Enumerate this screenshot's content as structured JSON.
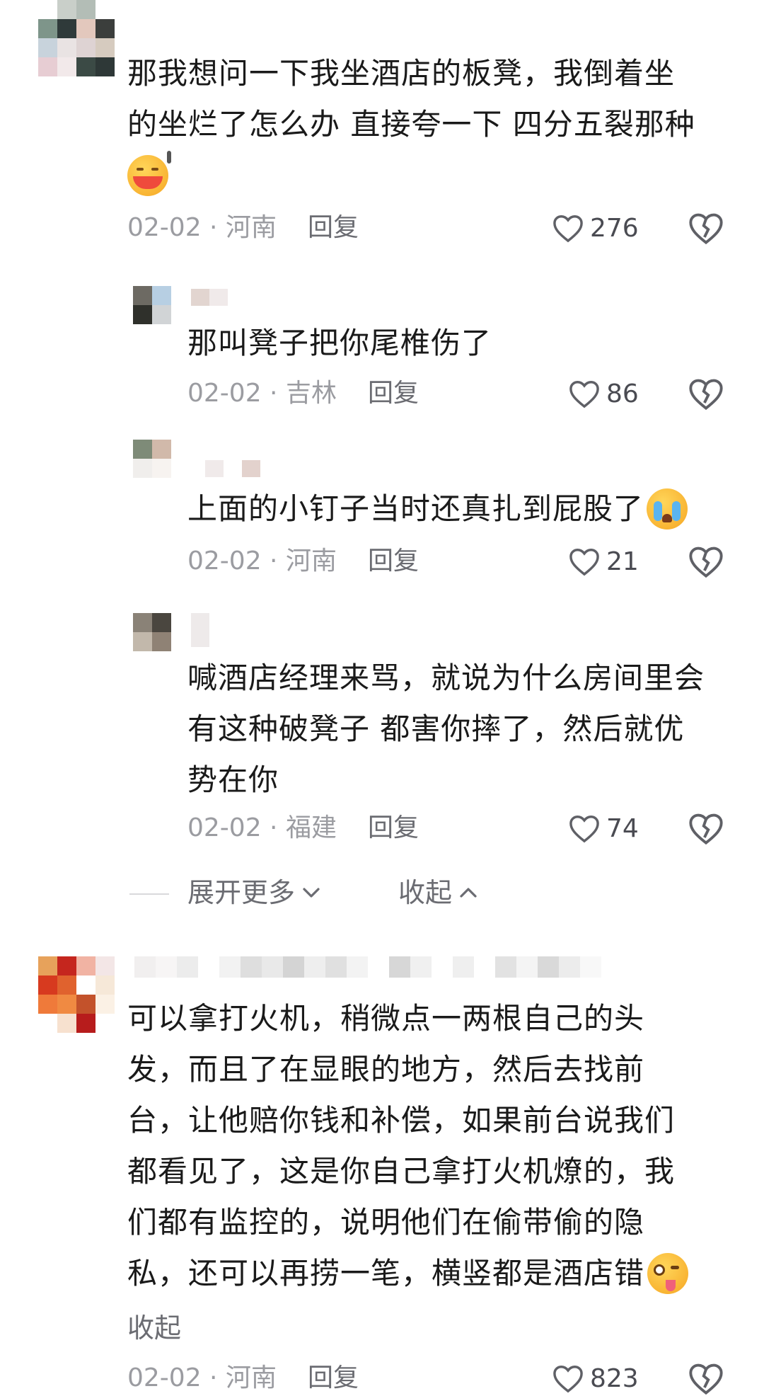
{
  "comments": [
    {
      "text_lines": [
        "那我想问一下我坐酒店的板凳，我倒着坐",
        "的坐烂了怎么办 直接夸一下 四分五裂那种"
      ],
      "date_location": "02-02 · 河南",
      "reply_label": "回复",
      "likes": "276",
      "emoji": "grinning-sweat-emoji"
    }
  ],
  "replies": [
    {
      "text_lines": [
        "那叫凳子把你尾椎伤了"
      ],
      "date_location": "02-02 · 吉林",
      "reply_label": "回复",
      "likes": "86"
    },
    {
      "text_lines": [
        "上面的小钉子当时还真扎到屁股了"
      ],
      "date_location": "02-02 · 河南",
      "reply_label": "回复",
      "likes": "21",
      "emoji": "crying-emoji"
    },
    {
      "text_lines": [
        "喊酒店经理来骂，就说为什么房间里会",
        "有这种破凳子 都害你摔了，然后就优",
        "势在你"
      ],
      "date_location": "02-02 · 福建",
      "reply_label": "回复",
      "likes": "74"
    }
  ],
  "thread_controls": {
    "expand_more": "展开更多",
    "collapse": "收起"
  },
  "second_comment": {
    "text_lines": [
      "可以拿打火机，稍微点一两根自己的头",
      "发，而且了在显眼的地方，然后去找前",
      "台，让他赔你钱和补偿，如果前台说我们",
      "都看见了，这是你自己拿打火机燎的，我",
      "们都有监控的，说明他们在偷带偷的隐",
      "私，还可以再捞一笔，横竖都是酒店错"
    ],
    "collapse_label": "收起",
    "date_location": "02-02 · 河南",
    "reply_label": "回复",
    "likes": "823",
    "emoji": "woozy-tongue-emoji"
  },
  "colors": {
    "text": "#1a1a1a",
    "meta": "#9b9ca1",
    "icon": "#5f6066"
  }
}
